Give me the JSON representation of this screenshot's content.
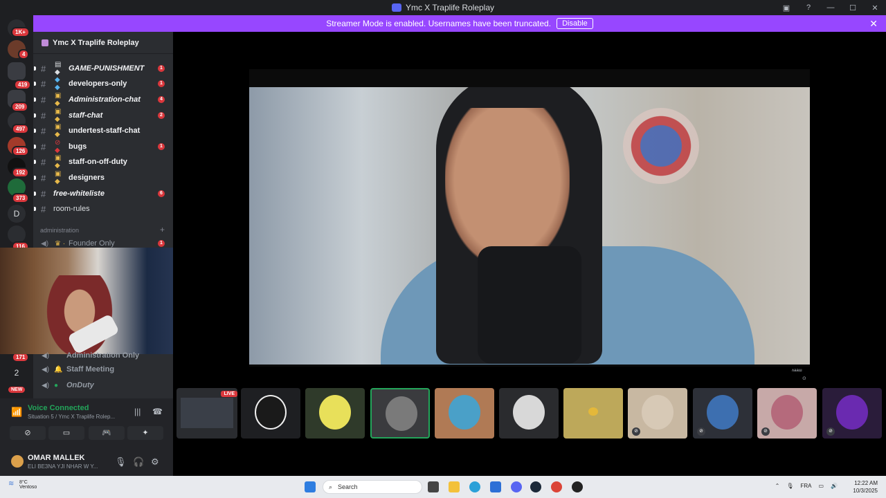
{
  "window": {
    "title": "Ymc X Traplife Roleplay"
  },
  "banner": {
    "text": "Streamer Mode is enabled. Usernames have been truncated.",
    "button": "Disable"
  },
  "servers": {
    "badges": [
      "1K+",
      "4",
      "419",
      "209",
      "497",
      "126",
      "192",
      "373",
      "116",
      "171"
    ],
    "letter": "D",
    "number": "2",
    "new_label": "NEW"
  },
  "channels": {
    "guild": "Ymc X Traplife Roleplay",
    "list": [
      {
        "name": "GAME-PUNISHMENT",
        "italic": true,
        "count": "1"
      },
      {
        "name": "developers-only",
        "italic": false,
        "count": "1"
      },
      {
        "name": "Administration-chat",
        "italic": true,
        "count": "4"
      },
      {
        "name": "staff-chat",
        "italic": true,
        "count": "2"
      },
      {
        "name": "undertest-staff-chat",
        "italic": false,
        "count": ""
      },
      {
        "name": "bugs",
        "italic": false,
        "count": "1"
      },
      {
        "name": "staff-on-off-duty",
        "italic": false,
        "count": ""
      },
      {
        "name": "designers",
        "italic": false,
        "count": ""
      },
      {
        "name": "free-whiteliste",
        "italic": true,
        "count": "6"
      },
      {
        "name": "room-rules",
        "italic": false,
        "count": ""
      }
    ],
    "category": "administration",
    "voice_top": {
      "name": "Founder Only",
      "count": "1"
    },
    "voice_partial": "Administration Only",
    "voice_rest": [
      "Staff Meeting",
      "OnDuty"
    ]
  },
  "voice_panel": {
    "status": "Voice Connected",
    "sub": "Situation 5 / Ymc X Traplife Rolep...",
    "user": "OMAR MALLEK",
    "user_status": "ELI BE3NA YJI NHAR W Y..."
  },
  "stage": {
    "video_label": "ʌaaɯ",
    "live_label": "LIVE"
  },
  "taskbar": {
    "temp": "8°C",
    "weather": "Ventoso",
    "search": "Search",
    "lang": "FRA",
    "time": "12:22 AM",
    "date": "10/3/2025"
  },
  "colors": {
    "accent": "#9747ff",
    "voice_green": "#23a55a",
    "badge_red": "#da373c",
    "brand": "#5865f2"
  }
}
